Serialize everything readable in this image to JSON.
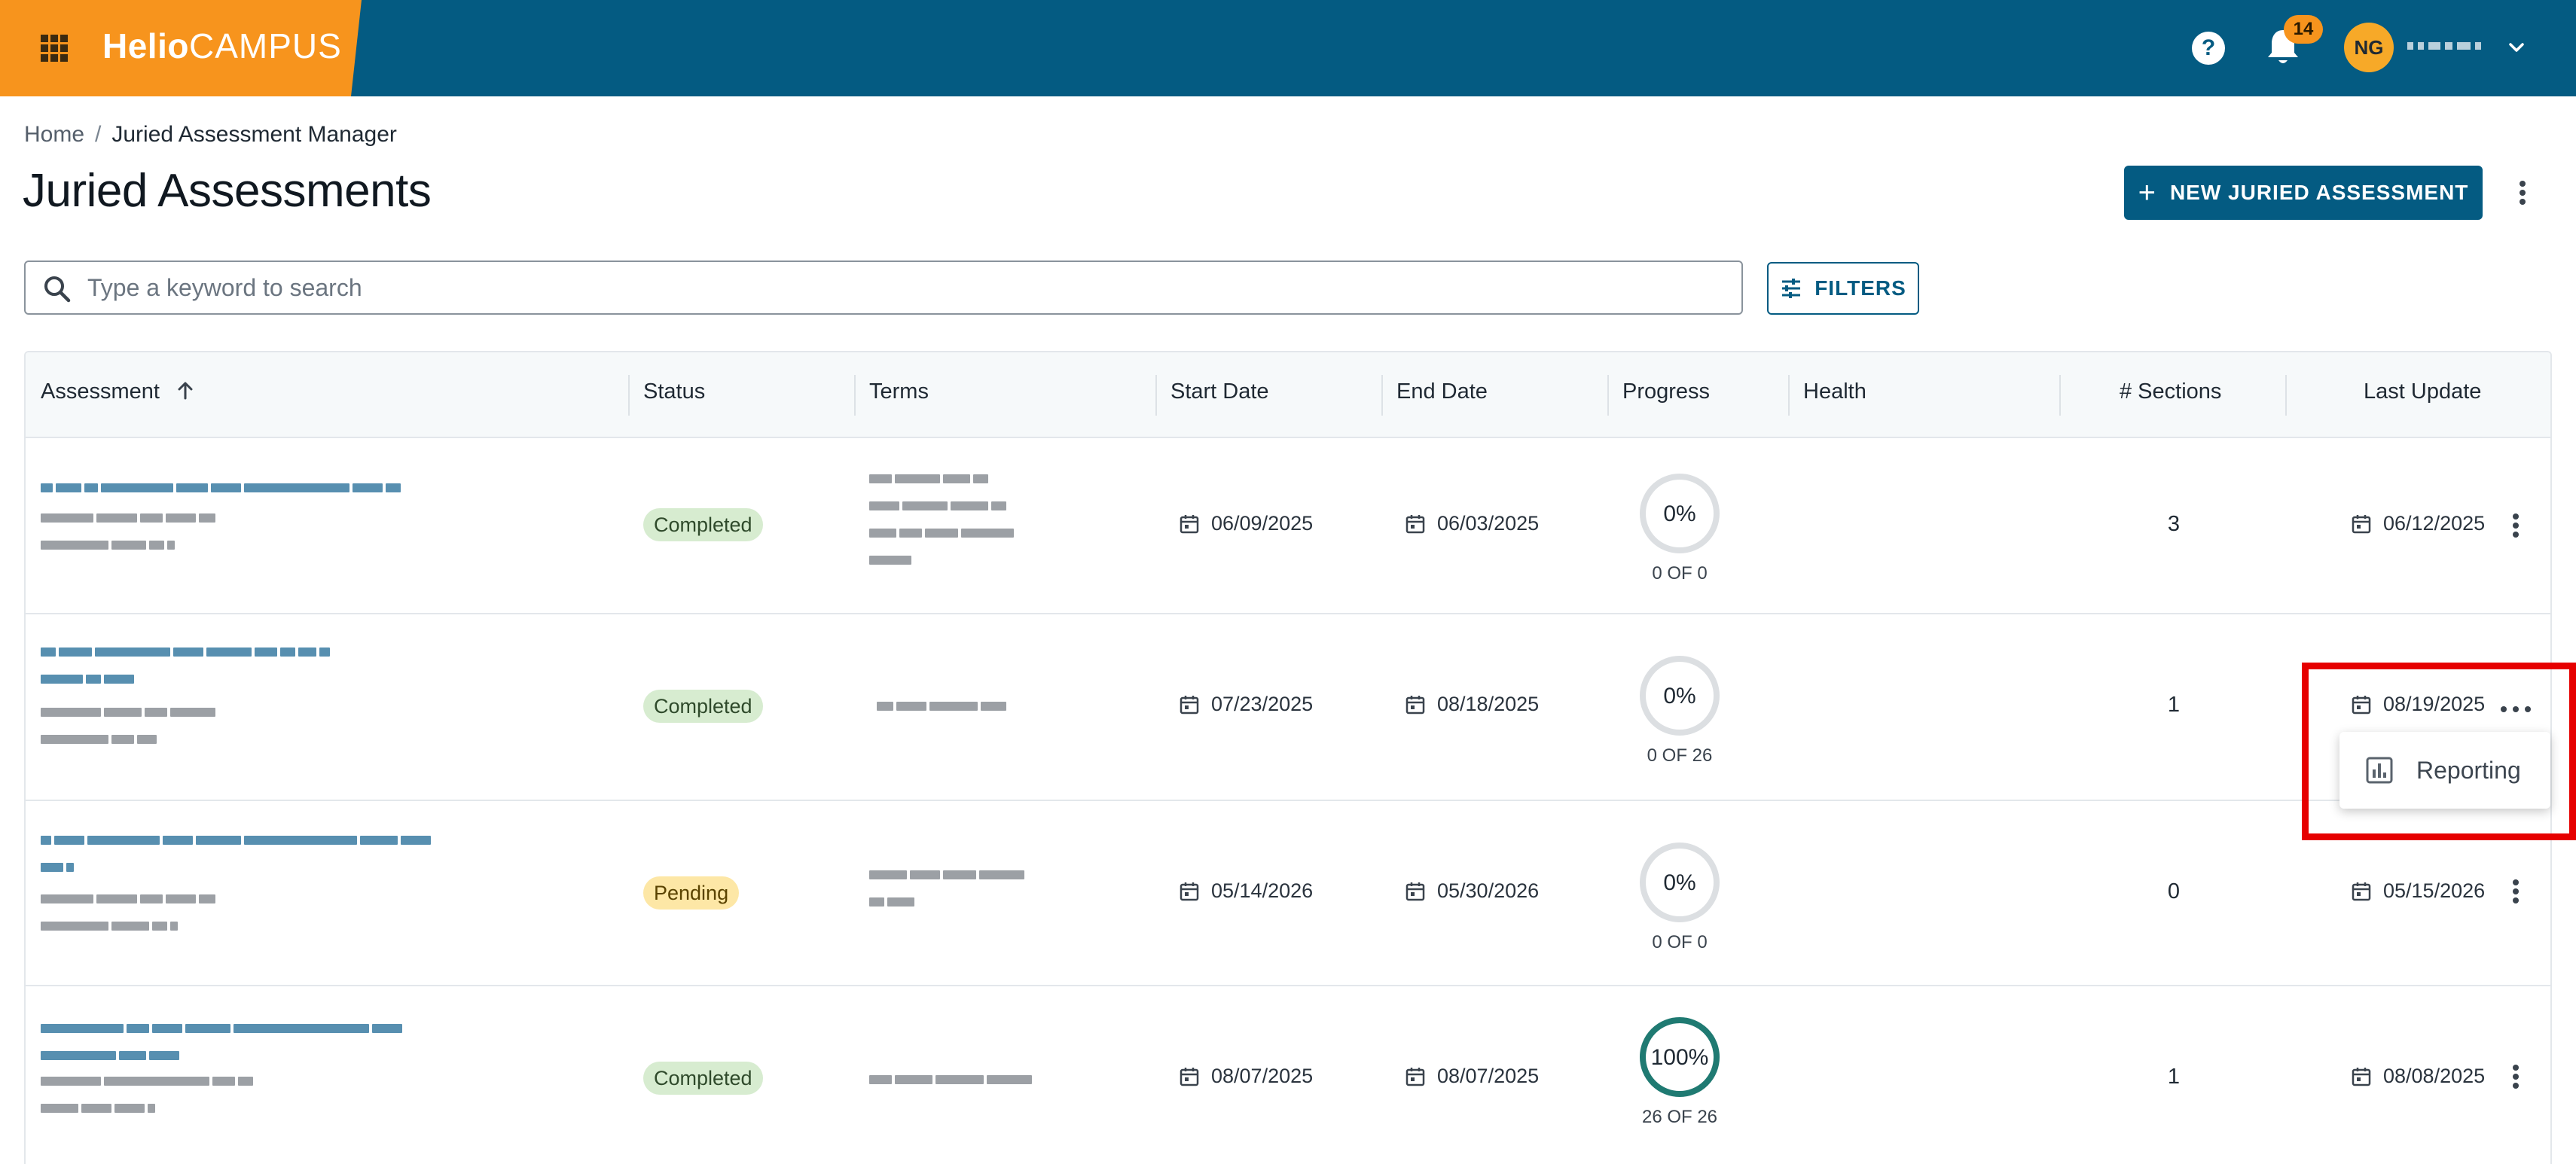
{
  "header": {
    "logo_bold": "Helio",
    "logo_light": "CAMPUS",
    "help_label": "?",
    "notification_count": "14",
    "user_initials": "NG",
    "brand_color": "#f7941d",
    "bar_color": "#045b82"
  },
  "breadcrumb": {
    "home": "Home",
    "separator": "/",
    "current": "Juried Assessment Manager"
  },
  "page": {
    "title": "Juried Assessments",
    "new_button": "NEW JURIED ASSESSMENT",
    "search_placeholder": "Type a keyword to search",
    "filters_button": "FILTERS"
  },
  "table": {
    "columns": [
      "Assessment",
      "Status",
      "Terms",
      "Start Date",
      "End Date",
      "Progress",
      "Health",
      "# Sections",
      "Last Update"
    ],
    "sort_column": "Assessment",
    "sort_direction": "ascending",
    "rows": [
      {
        "status": "Completed",
        "start": "06/09/2025",
        "end": "06/03/2025",
        "progress_pct": "0%",
        "progress_fraction": 0,
        "progress_label": "0 OF 0",
        "sections": "3",
        "last_update": "06/12/2025"
      },
      {
        "status": "Completed",
        "start": "07/23/2025",
        "end": "08/18/2025",
        "progress_pct": "0%",
        "progress_fraction": 0,
        "progress_label": "0 OF 26",
        "sections": "1",
        "last_update": "08/19/2025"
      },
      {
        "status": "Pending",
        "start": "05/14/2026",
        "end": "05/30/2026",
        "progress_pct": "0%",
        "progress_fraction": 0,
        "progress_label": "0 OF 0",
        "sections": "0",
        "last_update": "05/15/2026"
      },
      {
        "status": "Completed",
        "start": "08/07/2025",
        "end": "08/07/2025",
        "progress_pct": "100%",
        "progress_fraction": 1,
        "progress_label": "26 OF 26",
        "sections": "1",
        "last_update": "08/08/2025"
      }
    ]
  },
  "row_menu": {
    "reporting": "Reporting"
  },
  "colors": {
    "completed_chip": "#d7ecd0",
    "pending_chip": "#fde7a6",
    "progress_complete": "#1f7a72",
    "progress_track": "#dcdfe2",
    "highlight": "#e60000"
  }
}
